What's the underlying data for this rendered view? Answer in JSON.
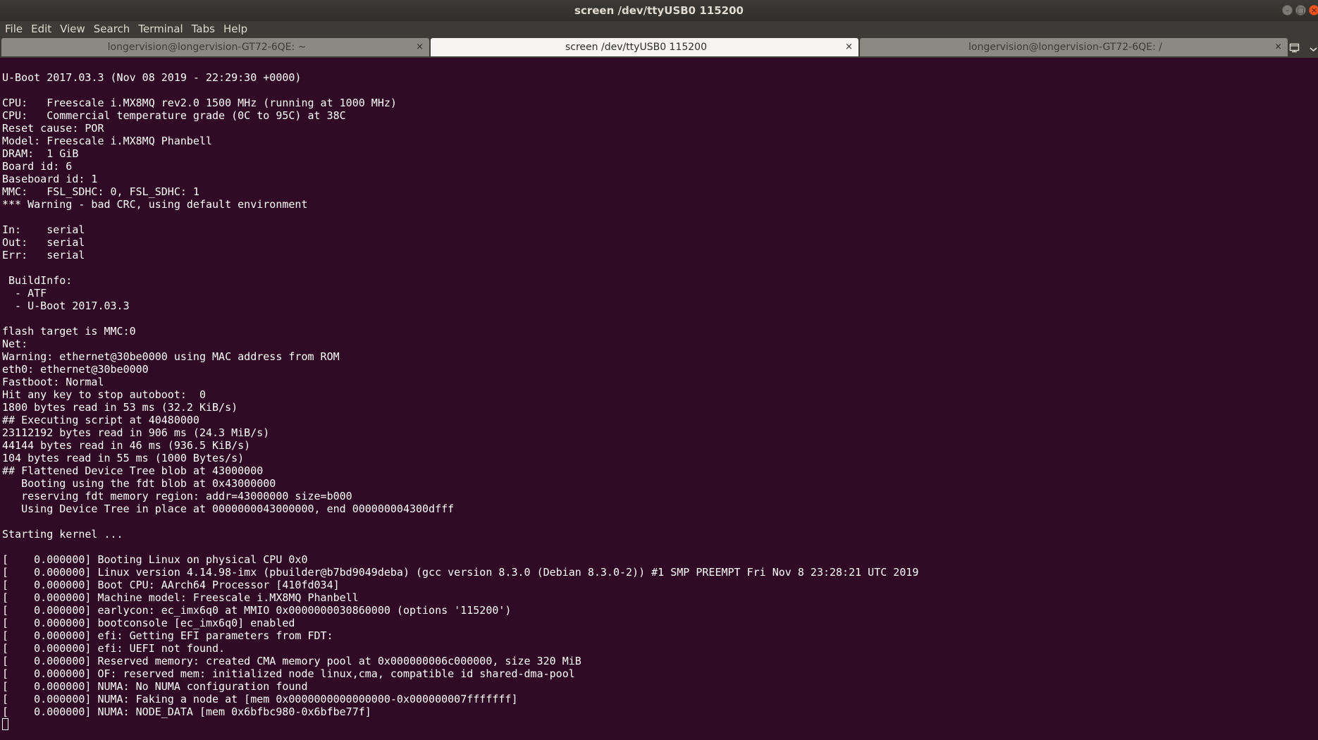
{
  "window": {
    "title": "screen /dev/ttyUSB0 115200"
  },
  "menubar": {
    "items": [
      "File",
      "Edit",
      "View",
      "Search",
      "Terminal",
      "Tabs",
      "Help"
    ]
  },
  "tabs": [
    {
      "label": "longervision@longervision-GT72-6QE: ~",
      "active": false
    },
    {
      "label": "screen /dev/ttyUSB0 115200",
      "active": true
    },
    {
      "label": "longervision@longervision-GT72-6QE: /",
      "active": false
    }
  ],
  "tab_close_glyph": "×",
  "terminal": {
    "lines": [
      "U-Boot 2017.03.3 (Nov 08 2019 - 22:29:30 +0000)",
      "",
      "CPU:   Freescale i.MX8MQ rev2.0 1500 MHz (running at 1000 MHz)",
      "CPU:   Commercial temperature grade (0C to 95C) at 38C",
      "Reset cause: POR",
      "Model: Freescale i.MX8MQ Phanbell",
      "DRAM:  1 GiB",
      "Board id: 6",
      "Baseboard id: 1",
      "MMC:   FSL_SDHC: 0, FSL_SDHC: 1",
      "*** Warning - bad CRC, using default environment",
      "",
      "In:    serial",
      "Out:   serial",
      "Err:   serial",
      "",
      " BuildInfo:",
      "  - ATF",
      "  - U-Boot 2017.03.3",
      "",
      "flash target is MMC:0",
      "Net:",
      "Warning: ethernet@30be0000 using MAC address from ROM",
      "eth0: ethernet@30be0000",
      "Fastboot: Normal",
      "Hit any key to stop autoboot:  0",
      "1800 bytes read in 53 ms (32.2 KiB/s)",
      "## Executing script at 40480000",
      "23112192 bytes read in 906 ms (24.3 MiB/s)",
      "44144 bytes read in 46 ms (936.5 KiB/s)",
      "104 bytes read in 55 ms (1000 Bytes/s)",
      "## Flattened Device Tree blob at 43000000",
      "   Booting using the fdt blob at 0x43000000",
      "   reserving fdt memory region: addr=43000000 size=b000",
      "   Using Device Tree in place at 0000000043000000, end 000000004300dfff",
      "",
      "Starting kernel ...",
      "",
      "[    0.000000] Booting Linux on physical CPU 0x0",
      "[    0.000000] Linux version 4.14.98-imx (pbuilder@b7bd9049deba) (gcc version 8.3.0 (Debian 8.3.0-2)) #1 SMP PREEMPT Fri Nov 8 23:28:21 UTC 2019",
      "[    0.000000] Boot CPU: AArch64 Processor [410fd034]",
      "[    0.000000] Machine model: Freescale i.MX8MQ Phanbell",
      "[    0.000000] earlycon: ec_imx6q0 at MMIO 0x0000000030860000 (options '115200')",
      "[    0.000000] bootconsole [ec_imx6q0] enabled",
      "[    0.000000] efi: Getting EFI parameters from FDT:",
      "[    0.000000] efi: UEFI not found.",
      "[    0.000000] Reserved memory: created CMA memory pool at 0x000000006c000000, size 320 MiB",
      "[    0.000000] OF: reserved mem: initialized node linux,cma, compatible id shared-dma-pool",
      "[    0.000000] NUMA: No NUMA configuration found",
      "[    0.000000] NUMA: Faking a node at [mem 0x0000000000000000-0x000000007fffffff]",
      "[    0.000000] NUMA: NODE_DATA [mem 0x6bfbc980-0x6bfbe77f]"
    ]
  },
  "colors": {
    "terminal_bg": "#300a24",
    "terminal_fg": "#ffffff",
    "chrome_bg": "#3c3b37",
    "close_button": "#e95420"
  },
  "icons": {
    "new_tab": "new-tab-icon",
    "tab_menu": "chevron-down-icon",
    "minimize": "minimize-icon",
    "maximize": "maximize-icon",
    "close": "close-icon"
  }
}
